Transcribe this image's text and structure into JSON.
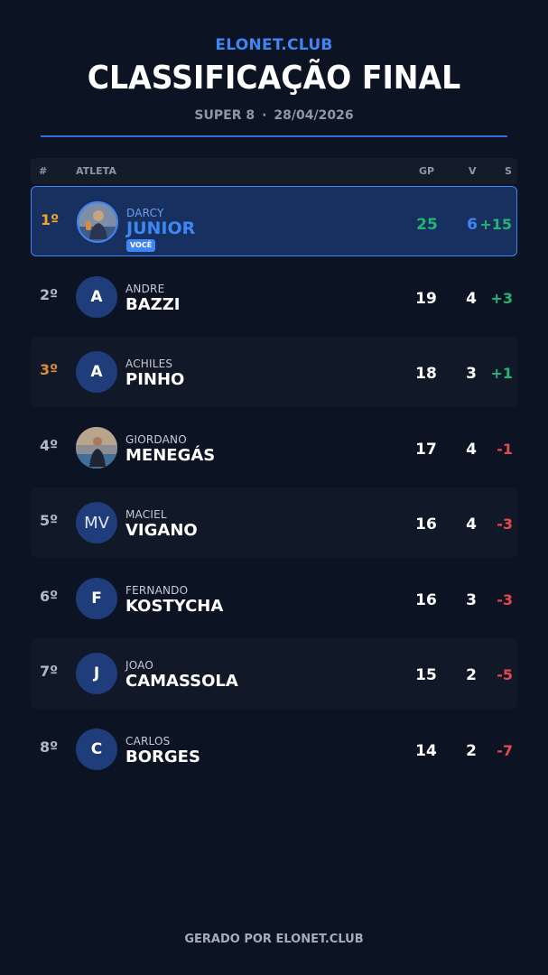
{
  "brand": "ELONET.CLUB",
  "title": "CLASSIFICAÇÃO FINAL",
  "subtitle": {
    "event": "SUPER 8",
    "separator": "·",
    "date": "28/04/2026"
  },
  "columns": {
    "rank": "#",
    "athlete": "ATLETA",
    "gp": "GP",
    "v": "V",
    "s": "S"
  },
  "you_label": "VOCÊ",
  "rows": [
    {
      "rank": "1º",
      "first": "DARCY",
      "last": "JUNIOR",
      "avatar": "",
      "gp": "25",
      "v": "6",
      "s": "+15"
    },
    {
      "rank": "2º",
      "first": "ANDRE",
      "last": "BAZZI",
      "avatar": "A",
      "gp": "19",
      "v": "4",
      "s": "+3"
    },
    {
      "rank": "3º",
      "first": "ACHILES",
      "last": "PINHO",
      "avatar": "A",
      "gp": "18",
      "v": "3",
      "s": "+1"
    },
    {
      "rank": "4º",
      "first": "GIORDANO",
      "last": "MENEGÁS",
      "avatar": "",
      "gp": "17",
      "v": "4",
      "s": "-1"
    },
    {
      "rank": "5º",
      "first": "MACIEL",
      "last": "VIGANO",
      "avatar": "MV",
      "gp": "16",
      "v": "4",
      "s": "-3"
    },
    {
      "rank": "6º",
      "first": "FERNANDO",
      "last": "KOSTYCHA",
      "avatar": "F",
      "gp": "16",
      "v": "3",
      "s": "-3"
    },
    {
      "rank": "7º",
      "first": "JOAO",
      "last": "CAMASSOLA",
      "avatar": "J",
      "gp": "15",
      "v": "2",
      "s": "-5"
    },
    {
      "rank": "8º",
      "first": "CARLOS",
      "last": "BORGES",
      "avatar": "C",
      "gp": "14",
      "v": "2",
      "s": "-7"
    }
  ],
  "footer": "GERADO POR ELONET.CLUB",
  "colors": {
    "background": "#0c1322",
    "accent": "#3f86f5",
    "positive": "#22b573",
    "negative": "#e5484d",
    "gold": "#f5a524"
  }
}
